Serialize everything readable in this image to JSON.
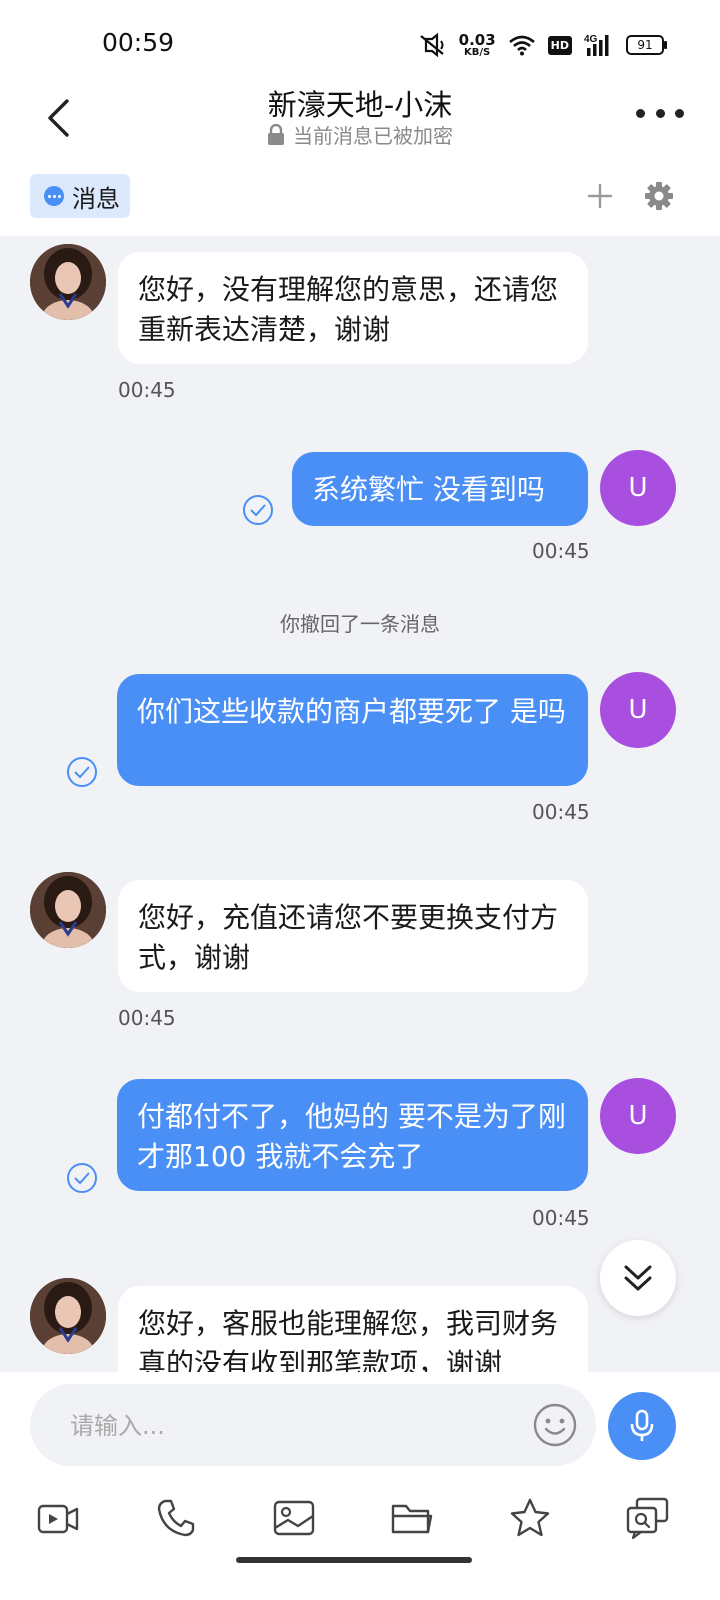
{
  "status_bar": {
    "time": "00:59",
    "net_speed_value": "0.03",
    "net_speed_unit": "KB/S",
    "hd_label": "HD",
    "signal_label": "4G",
    "battery_level": "91"
  },
  "header": {
    "title": "新濠天地-小沫",
    "subtitle": "当前消息已被加密"
  },
  "tabs": {
    "active_label": "消息"
  },
  "messages": [
    {
      "side": "in",
      "text": "您好，没有理解您的意思，还请您重新表达清楚，谢谢",
      "time": "00:45"
    },
    {
      "side": "out",
      "text": "系统繁忙 没看到吗",
      "time": "00:45",
      "avatar": "U"
    },
    {
      "system": "你撤回了一条消息"
    },
    {
      "side": "out",
      "text": "你们这些收款的商户都要死了 是吗",
      "time": "00:45",
      "avatar": "U"
    },
    {
      "side": "in",
      "text": "您好，充值还请您不要更换支付方式，谢谢",
      "time": "00:45"
    },
    {
      "side": "out",
      "text": "付都付不了，他妈的 要不是为了刚才那100 我就不会充了",
      "time": "00:45",
      "avatar": "U"
    },
    {
      "side": "in",
      "text": "您好，客服也能理解您，我司财务真的没有收到那笔款项，谢谢"
    }
  ],
  "input": {
    "placeholder": "请输入..."
  },
  "colors": {
    "accent": "#4a8ff5",
    "user_avatar": "#a94fe0",
    "chat_bg": "#f1f2f6"
  },
  "toolbar_icons": [
    "video-icon",
    "phone-icon",
    "image-icon",
    "folder-icon",
    "star-icon",
    "search-chat-icon"
  ]
}
